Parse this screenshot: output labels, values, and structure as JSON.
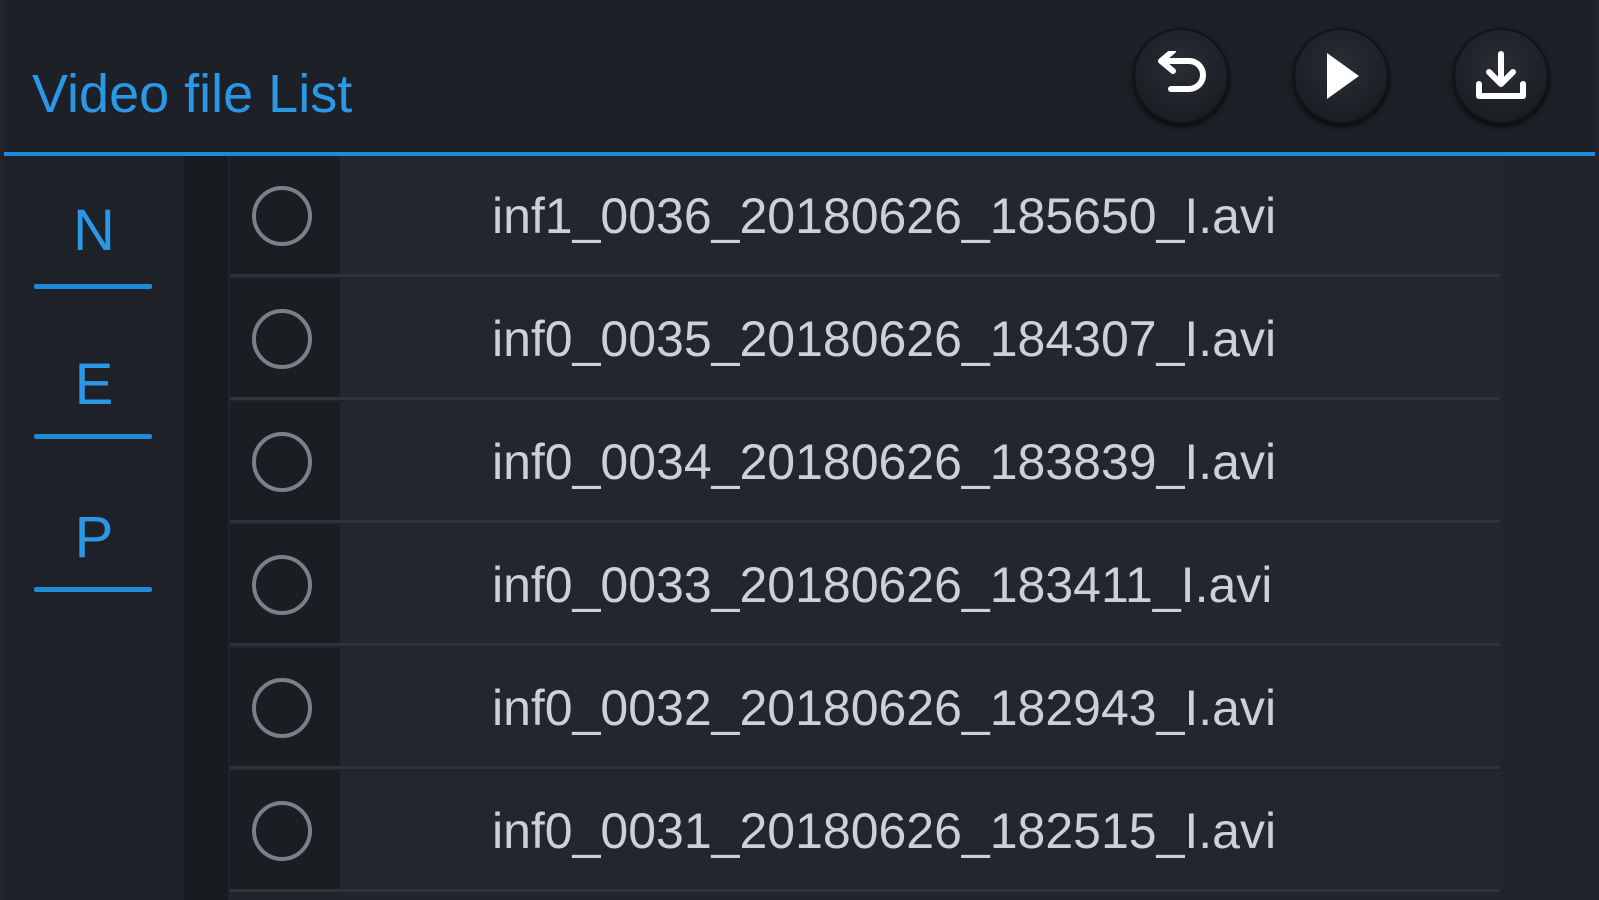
{
  "header": {
    "title": "Video file List",
    "buttons": [
      {
        "icon": "undo-arrow-icon"
      },
      {
        "icon": "play-icon"
      },
      {
        "icon": "download-icon"
      }
    ]
  },
  "tabs": [
    {
      "label": "N"
    },
    {
      "label": "E"
    },
    {
      "label": "P"
    }
  ],
  "files": [
    {
      "name": "inf1_0036_20180626_185650_I.avi",
      "selected": false
    },
    {
      "name": "inf0_0035_20180626_184307_I.avi",
      "selected": false
    },
    {
      "name": "inf0_0034_20180626_183839_I.avi",
      "selected": false
    },
    {
      "name": "inf0_0033_20180626_183411_I.avi",
      "selected": false
    },
    {
      "name": "inf0_0032_20180626_182943_I.avi",
      "selected": false
    },
    {
      "name": "inf0_0031_20180626_182515_I.avi",
      "selected": false
    }
  ],
  "colors": {
    "accent": "#1f8ad8",
    "background": "#20242b",
    "text": "#cdd0d4"
  }
}
